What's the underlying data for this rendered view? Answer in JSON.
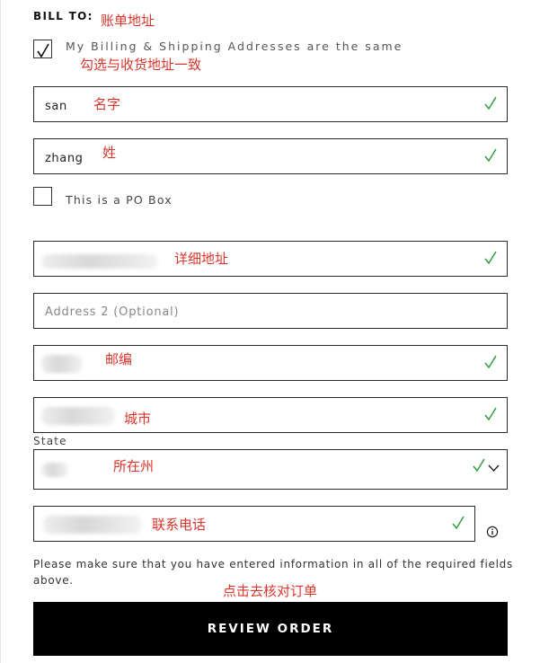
{
  "billing": {
    "heading": "BILL TO:",
    "heading_annotation": "账单地址",
    "same_address": {
      "checked": true,
      "label": "My Billing & Shipping Addresses are the same",
      "annotation": "勾选与收货地址一致"
    },
    "first_name": {
      "value": "san",
      "annotation": "名字",
      "valid": true
    },
    "last_name": {
      "value": "zhang",
      "annotation": "姓",
      "valid": true
    },
    "po_box": {
      "checked": false,
      "label": "This is a PO Box"
    },
    "address1": {
      "annotation": "详细地址",
      "valid": true
    },
    "address2": {
      "value": "",
      "placeholder": "Address 2 (Optional)"
    },
    "zip": {
      "annotation": "邮编",
      "valid": true
    },
    "city": {
      "annotation": "城市",
      "valid": true
    },
    "state": {
      "label": "State",
      "annotation": "所在州",
      "valid": true
    },
    "phone": {
      "annotation": "联系电话",
      "valid": true
    }
  },
  "notice": "Please make sure that you have entered information in all of the required fields above.",
  "review_button": {
    "label": "REVIEW ORDER",
    "annotation": "点击去核对订单"
  },
  "colors": {
    "valid_check": "#2e9e3e",
    "annotation_text": "#d9362b",
    "button_bg": "#000000",
    "button_text": "#ffffff"
  },
  "icons": [
    "checkmark-icon",
    "chevron-down-icon",
    "info-icon"
  ]
}
